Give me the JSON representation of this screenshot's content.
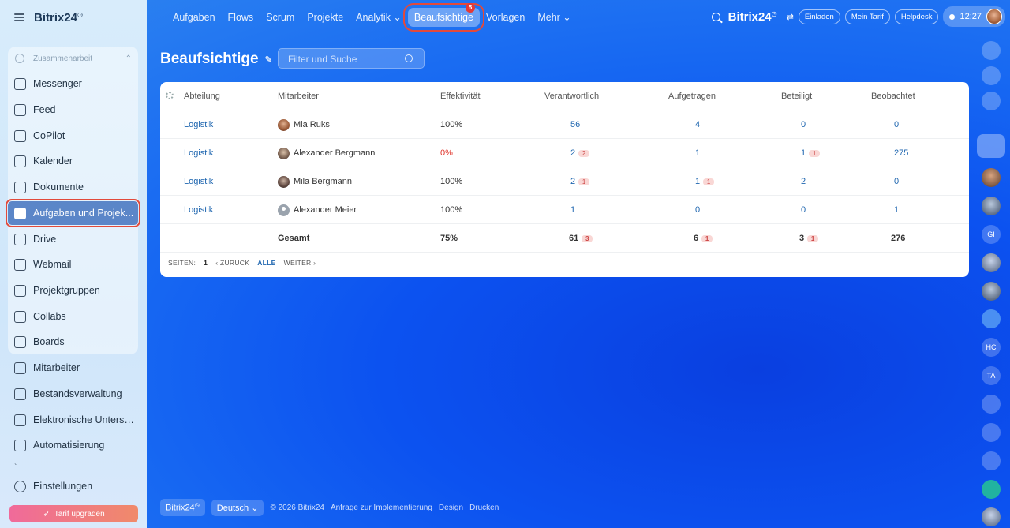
{
  "sidebar": {
    "brand": "Bitrix24",
    "brand_mark": "◷",
    "group_label": "Zusammenarbeit",
    "items": [
      {
        "label": "Messenger",
        "icon": "messenger-icon"
      },
      {
        "label": "Feed",
        "icon": "feed-icon"
      },
      {
        "label": "CoPilot",
        "icon": "copilot-icon"
      },
      {
        "label": "Kalender",
        "icon": "calendar-icon"
      },
      {
        "label": "Dokumente",
        "icon": "documents-icon"
      },
      {
        "label": "Aufgaben und Projek...",
        "icon": "tasks-icon",
        "active": true
      },
      {
        "label": "Drive",
        "icon": "drive-icon"
      },
      {
        "label": "Webmail",
        "icon": "mail-icon"
      },
      {
        "label": "Projektgruppen",
        "icon": "groups-icon"
      },
      {
        "label": "Collabs",
        "icon": "collabs-icon"
      },
      {
        "label": "Boards",
        "icon": "boards-icon"
      },
      {
        "label": "Mitarbeiter",
        "icon": "employees-icon"
      },
      {
        "label": "Bestandsverwaltung",
        "icon": "inventory-icon"
      },
      {
        "label": "Elektronische Untersc...",
        "icon": "esign-icon"
      },
      {
        "label": "Automatisierung",
        "icon": "automation-icon"
      }
    ],
    "tick": "`",
    "settings": "Einstellungen",
    "upgrade": "Tarif upgraden"
  },
  "topnav": {
    "items": [
      "Aufgaben",
      "Flows",
      "Scrum",
      "Projekte",
      "Analytik",
      "Beaufsichtige",
      "Vorlagen",
      "Mehr"
    ],
    "selected_badge": "5",
    "brand": "Bitrix24",
    "invite": "Einladen",
    "plan": "Mein Tarif",
    "helpdesk": "Helpdesk",
    "time": "12:27"
  },
  "page": {
    "title": "Beaufsichtige",
    "filter_placeholder": "Filter und Suche"
  },
  "table": {
    "headers": [
      "Abteilung",
      "Mitarbeiter",
      "Effektivität",
      "Verantwortlich",
      "Aufgetragen",
      "Beteiligt",
      "Beobachtet"
    ],
    "rows": [
      {
        "dept": "Logistik",
        "name": "Mia Ruks",
        "eff": "100%",
        "resp": "56",
        "resp_c": "",
        "assigned": "4",
        "assigned_c": "",
        "part": "0",
        "part_c": "",
        "obs": "0"
      },
      {
        "dept": "Logistik",
        "name": "Alexander Bergmann",
        "eff": "0%",
        "resp": "2",
        "resp_c": "2",
        "assigned": "1",
        "assigned_c": "",
        "part": "1",
        "part_c": "1",
        "obs": "275"
      },
      {
        "dept": "Logistik",
        "name": "Mila Bergmann",
        "eff": "100%",
        "resp": "2",
        "resp_c": "1",
        "assigned": "1",
        "assigned_c": "1",
        "part": "2",
        "part_c": "",
        "obs": "0"
      },
      {
        "dept": "Logistik",
        "name": "Alexander Meier",
        "eff": "100%",
        "resp": "1",
        "resp_c": "",
        "assigned": "0",
        "assigned_c": "",
        "part": "0",
        "part_c": "",
        "obs": "1"
      }
    ],
    "total": {
      "label": "Gesamt",
      "eff": "75%",
      "resp": "61",
      "resp_c": "3",
      "assigned": "6",
      "assigned_c": "1",
      "part": "3",
      "part_c": "1",
      "obs": "276"
    },
    "pager": {
      "pages_label": "SEITEN:",
      "page": "1",
      "prev": "ZURÜCK",
      "all": "ALLE",
      "next": "WEITER"
    }
  },
  "rail": {
    "initials": [
      "GI",
      "HC",
      "TA"
    ]
  },
  "footer": {
    "brand": "Bitrix24",
    "language": "Deutsch",
    "copyright": "© 2026 Bitrix24",
    "implementation": "Anfrage zur Implementierung",
    "design": "Design",
    "print": "Drucken"
  },
  "colors": {
    "accent": "#2067b0",
    "danger": "#e0352b",
    "highlight_outline": "#e24a3b"
  }
}
